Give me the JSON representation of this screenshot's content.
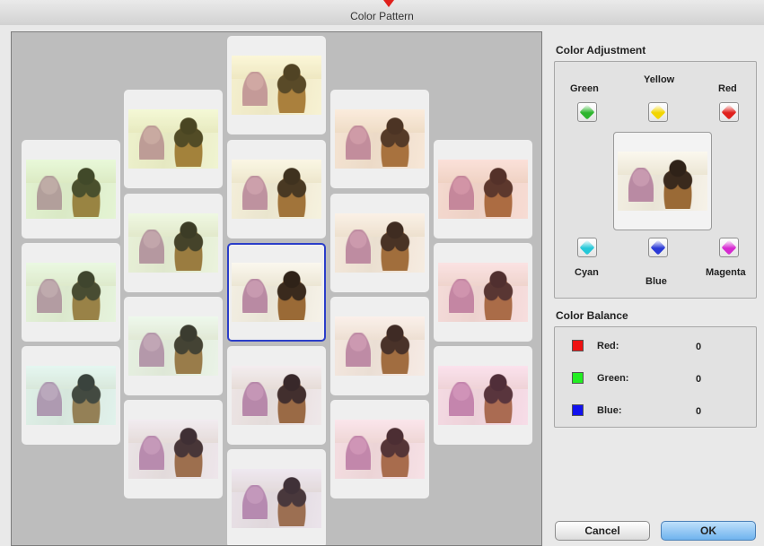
{
  "window": {
    "title": "Color Pattern"
  },
  "pattern": {
    "thumbnails": [
      {
        "tint": "rgba(150,255,120,0.18)"
      },
      {
        "tint": "rgba(150,255,160,0.16)"
      },
      {
        "tint": "rgba(120,240,255,0.16)"
      },
      {
        "tint": "rgba(210,255,90,0.16)"
      },
      {
        "tint": "rgba(160,255,140,0.12)"
      },
      {
        "tint": "rgba(150,255,220,0.12)"
      },
      {
        "tint": "rgba(180,150,255,0.12)"
      },
      {
        "tint": "rgba(255,245,100,0.16)"
      },
      {
        "tint": "rgba(255,240,120,0.08)"
      },
      {
        "tint": "rgba(0,0,0,0)"
      },
      {
        "tint": "rgba(160,120,255,0.08)"
      },
      {
        "tint": "rgba(170,140,255,0.14)"
      },
      {
        "tint": "rgba(255,160,110,0.14)"
      },
      {
        "tint": "rgba(255,170,140,0.08)"
      },
      {
        "tint": "rgba(255,150,190,0.08)"
      },
      {
        "tint": "rgba(255,120,220,0.14)"
      },
      {
        "tint": "rgba(255,120,120,0.18)"
      },
      {
        "tint": "rgba(255,120,170,0.16)"
      },
      {
        "tint": "rgba(255,110,230,0.16)"
      }
    ],
    "selected_index": 9
  },
  "color_adjustment": {
    "heading": "Color Adjustment",
    "green": "Green",
    "yellow": "Yellow",
    "red": "Red",
    "cyan": "Cyan",
    "blue": "Blue",
    "magenta": "Magenta",
    "colors": {
      "green": "#2db52d",
      "yellow": "#f2d500",
      "red": "#e0201c",
      "cyan": "#25c8d8",
      "blue": "#2a39d6",
      "magenta": "#d62ad0"
    }
  },
  "color_balance": {
    "heading": "Color Balance",
    "red_label": "Red:",
    "red_value": "0",
    "green_label": "Green:",
    "green_value": "0",
    "blue_label": "Blue:",
    "blue_value": "0",
    "colors": {
      "red": "#ee1111",
      "green": "#22ee22",
      "blue": "#1111ee"
    }
  },
  "buttons": {
    "cancel": "Cancel",
    "ok": "OK"
  }
}
